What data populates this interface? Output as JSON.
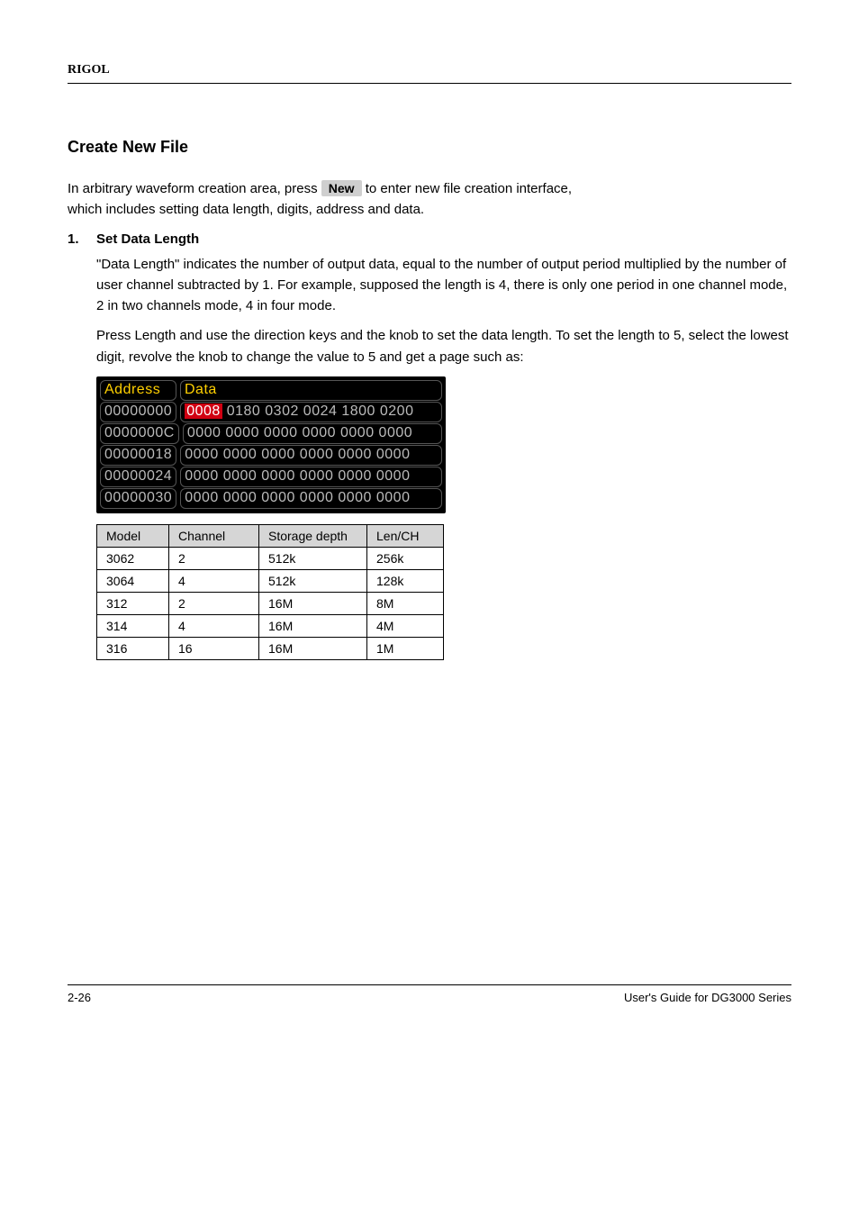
{
  "header": {
    "brand": "RIGOL"
  },
  "section": {
    "title": "Create New File"
  },
  "intro": {
    "line1_pre": "In arbitrary waveform creation area, press ",
    "line1_softkey": "New",
    "line1_post": " to enter new file creation interface,",
    "line2": "which includes setting data length, digits, address and data."
  },
  "step1": {
    "number": "1.",
    "title": "Set Data Length",
    "para1": "\"Data Length\" indicates the number of output data, equal to the number of output period multiplied by the number of user channel subtracted by 1. For example, supposed the length is 4, there is only one period in one channel mode, 2 in two channels mode, 4 in four mode.",
    "para2": "Press Length and use the direction keys and the knob to set the data length. To set the length to 5, select the lowest digit, revolve the knob to change the value to 5 and get a page such as:"
  },
  "screenshot": {
    "header_addr": "Address",
    "header_data": "Data",
    "rows": [
      {
        "addr": "00000000",
        "highlight": "0008",
        "data_rest": " 0180 0302 0024 1800 0200"
      },
      {
        "addr": "0000000C",
        "highlight": "",
        "data_rest": "0000 0000 0000 0000 0000 0000"
      },
      {
        "addr": "00000018",
        "highlight": "",
        "data_rest": "0000 0000 0000 0000 0000 0000"
      },
      {
        "addr": "00000024",
        "highlight": "",
        "data_rest": "0000 0000 0000 0000 0000 0000"
      },
      {
        "addr": "00000030",
        "highlight": "",
        "data_rest": "0000 0000 0000 0000 0000 0000"
      }
    ]
  },
  "spec_table": {
    "headers": [
      "Model",
      "Channel",
      "Storage depth",
      "Len/CH"
    ],
    "rows": [
      [
        "3062",
        "2",
        "512k",
        "256k"
      ],
      [
        "3064",
        "4",
        "512k",
        "128k"
      ],
      [
        "312",
        "2",
        "16M",
        "8M"
      ],
      [
        "314",
        "4",
        "16M",
        "4M"
      ],
      [
        "316",
        "16",
        "16M",
        "1M"
      ]
    ]
  },
  "footer": {
    "left": "2-26",
    "right": "User's Guide for DG3000 Series"
  }
}
